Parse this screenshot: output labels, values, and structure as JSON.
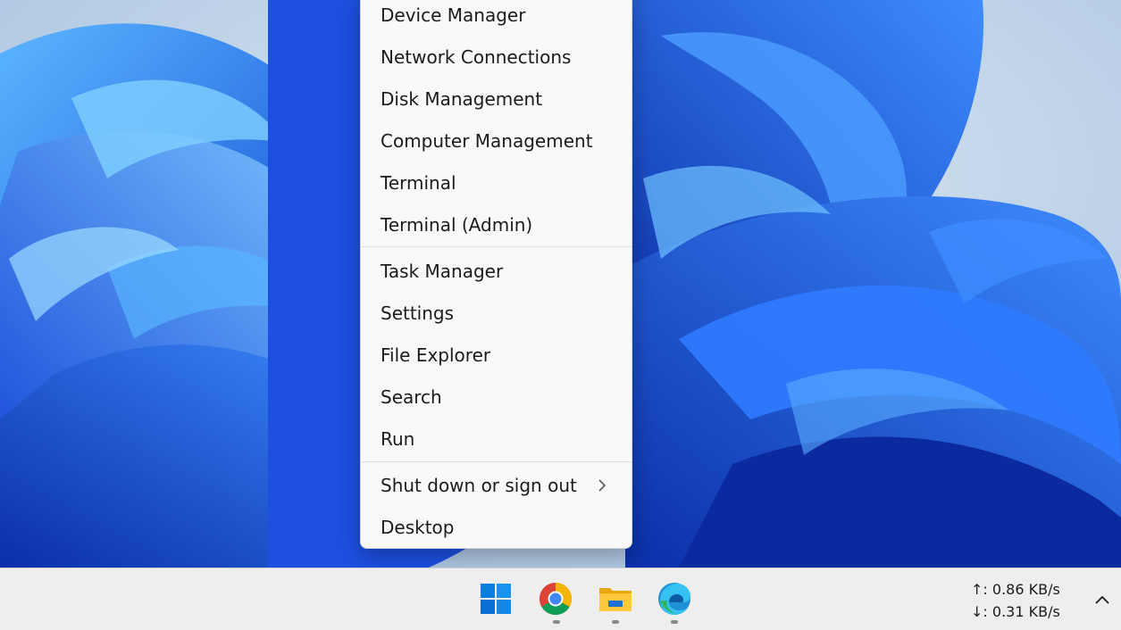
{
  "menu": {
    "items": [
      {
        "label": "Device Manager"
      },
      {
        "label": "Network Connections"
      },
      {
        "label": "Disk Management"
      },
      {
        "label": "Computer Management"
      },
      {
        "label": "Terminal"
      },
      {
        "label": "Terminal (Admin)"
      },
      {
        "label": "Task Manager"
      },
      {
        "label": "Settings"
      },
      {
        "label": "File Explorer"
      },
      {
        "label": "Search"
      },
      {
        "label": "Run"
      },
      {
        "label": "Shut down or sign out",
        "submenu_icon": "chevron-right-icon"
      },
      {
        "label": "Desktop"
      }
    ]
  },
  "taskbar": {
    "apps": [
      {
        "name": "Start",
        "icon": "windows-start-icon"
      },
      {
        "name": "Google Chrome",
        "icon": "chrome-icon",
        "running": true
      },
      {
        "name": "File Explorer",
        "icon": "file-explorer-icon",
        "running": true
      },
      {
        "name": "Microsoft Edge",
        "icon": "edge-icon",
        "running": true
      }
    ],
    "network": {
      "upload": "↑: 0.86 KB/s",
      "download": "↓: 0.31 KB/s"
    },
    "tray_overflow_icon": "chevron-up-icon"
  },
  "colors": {
    "menu_background": "#f9f9f9",
    "taskbar_background": "#eeeeee",
    "wallpaper_blue": "#1f5fe0",
    "start_blue": "#0a7ce0"
  }
}
